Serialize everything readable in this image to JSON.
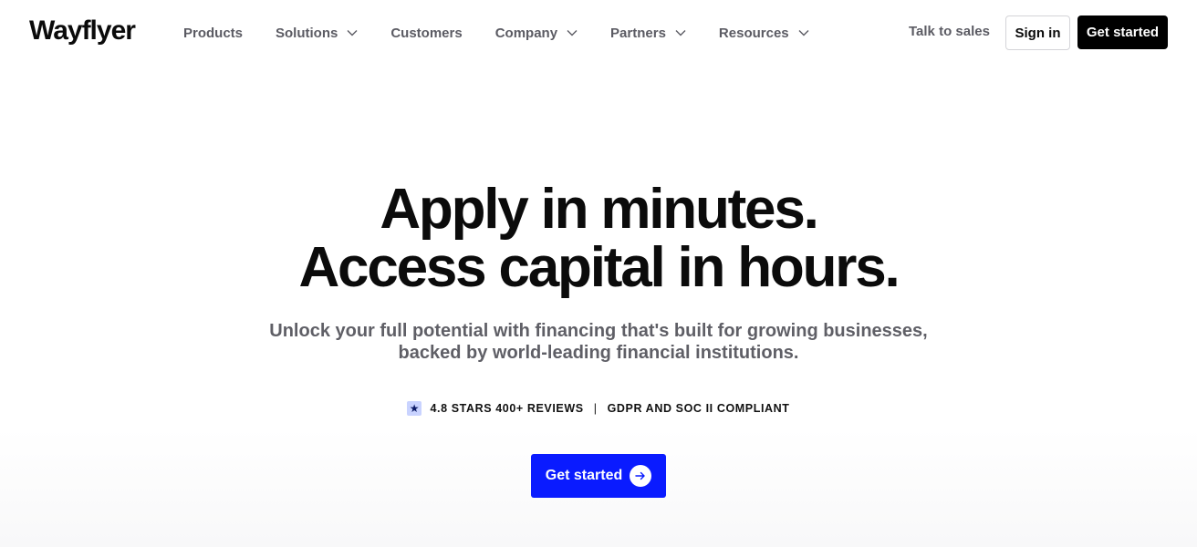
{
  "header": {
    "logo": "Wayflyer",
    "nav": [
      {
        "label": "Products",
        "has_dropdown": false
      },
      {
        "label": "Solutions",
        "has_dropdown": true
      },
      {
        "label": "Customers",
        "has_dropdown": false
      },
      {
        "label": "Company",
        "has_dropdown": true
      },
      {
        "label": "Partners",
        "has_dropdown": true
      },
      {
        "label": "Resources",
        "has_dropdown": true
      }
    ],
    "talk_to_sales": "Talk to sales",
    "sign_in": "Sign in",
    "get_started": "Get started"
  },
  "hero": {
    "title_line1": "Apply in minutes.",
    "title_line2": "Access capital in hours.",
    "subtitle_line1": "Unlock your full potential with financing that's built for growing businesses,",
    "subtitle_line2": "backed by world-leading financial institutions.",
    "rating": "4.8 STARS 400+ REVIEWS",
    "separator": "|",
    "compliance": "GDPR AND SOC II COMPLIANT",
    "cta": "Get started"
  },
  "colors": {
    "cta_blue": "#0a1bff",
    "nav_text": "#5b5b63",
    "subtitle_text": "#5f5f66",
    "star_badge": "#c9d3ff"
  },
  "icons": {
    "nav_dropdown": "chevron-down-icon",
    "rating": "star-icon",
    "cta": "arrow-right-icon"
  }
}
